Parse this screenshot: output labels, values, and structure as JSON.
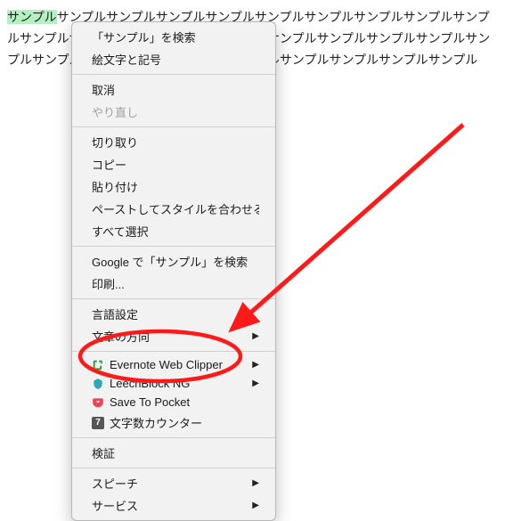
{
  "text": {
    "highlighted": "サンプル",
    "body_remaining": "サンプルサンプルサンプルサンプルサンプルサンプルサンプルサンプルサンプルサンプルサンプルサンプルサンプルサンプルサンプルサンプルサンプルサンプルサンプルサンプルサンプルサンプルサンプルサンプルサンプルサンプルサンプルサンプル"
  },
  "menu": {
    "search_selection": "「サンプル」を検索",
    "emoji_symbols": "絵文字と記号",
    "undo": "取消",
    "redo": "やり直し",
    "cut": "切り取り",
    "copy": "コピー",
    "paste": "貼り付け",
    "paste_match_style": "ペーストしてスタイルを合わせる",
    "select_all": "すべて選択",
    "google_search": "Google で「サンプル」を検索",
    "print": "印刷...",
    "language_settings": "言語設定",
    "text_direction": "文章の方向",
    "ext_evernote": "Evernote Web Clipper",
    "ext_leechblock": "LeechBlock NG",
    "ext_pocket": "Save To Pocket",
    "ext_counter": "文字数カウンター",
    "counter_icon_glyph": "7",
    "inspect": "検証",
    "speech": "スピーチ",
    "services": "サービス"
  }
}
